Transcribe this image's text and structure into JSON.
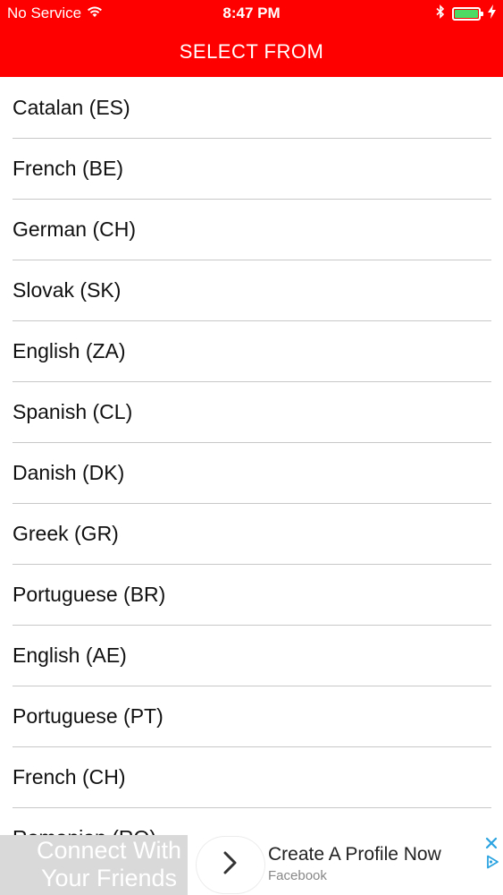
{
  "status_bar": {
    "carrier": "No Service",
    "time": "8:47 PM",
    "icons": [
      "wifi-icon",
      "bluetooth-icon",
      "battery-icon",
      "charging-icon"
    ]
  },
  "nav": {
    "title": "SELECT FROM"
  },
  "languages": [
    "Catalan (ES)",
    "French (BE)",
    "German (CH)",
    "Slovak (SK)",
    "English (ZA)",
    "Spanish (CL)",
    "Danish (DK)",
    "Greek (GR)",
    "Portuguese (BR)",
    "English (AE)",
    "Portuguese (PT)",
    "French (CH)",
    "Romanian (RO)"
  ],
  "ad": {
    "background_text": "Connect With Your Friends",
    "title": "Create A Profile Now",
    "subtitle": "Facebook"
  },
  "colors": {
    "brand": "#fe0000",
    "battery": "#4cd964",
    "ad_choices": "#2aa3e0"
  }
}
